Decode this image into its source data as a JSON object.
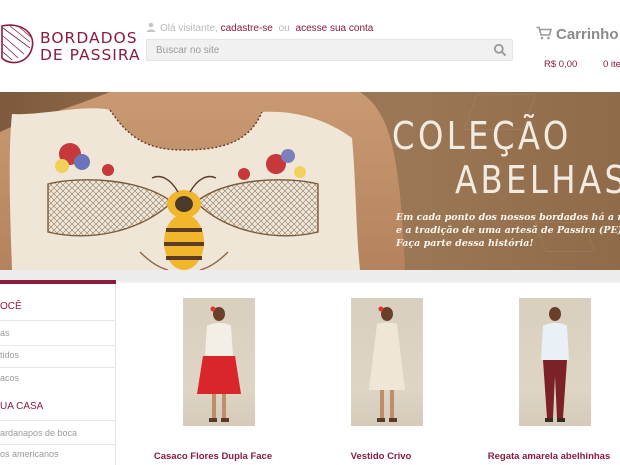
{
  "brand": {
    "line1": "BORDADOS",
    "line2": "DE PASSIRA",
    "color": "#8b1c3b"
  },
  "account": {
    "greeting": "Olá visitante,",
    "signup": "cadastre-se",
    "or": "ou",
    "login": "acesse sua conta",
    "icon": "user-icon"
  },
  "search": {
    "placeholder": "Buscar no site",
    "icon": "search-icon"
  },
  "cart": {
    "title": "Carrinho",
    "total": "R$ 0,00",
    "items": "0 ite",
    "icon": "cart-icon"
  },
  "banner": {
    "title_line1": "COLEÇÃO",
    "title_line2": "ABELHAS",
    "text_line1": "Em cada ponto dos nossos bordados há a memó",
    "text_line2": "e a tradição de uma artesã de Passira (PE).",
    "text_line3": "Faça parte dessa história!"
  },
  "sidebar": {
    "section1": {
      "heading": "OCÊ",
      "items": [
        "as",
        "tidos",
        "acos"
      ]
    },
    "section2": {
      "heading": "UA CASA",
      "items": [
        "ardanapos de boca",
        "os americanos"
      ]
    }
  },
  "products": [
    {
      "name": "Casaco Flores Dupla Face",
      "skirt_color": "#d8262a",
      "top_color": "#f4efe6"
    },
    {
      "name": "Vestido Crivo",
      "skirt_color": "#efe7d6",
      "top_color": "#efe7d6"
    },
    {
      "name": "Regata amarela abelhinhas",
      "skirt_color": "#7a2226",
      "top_color": "#eaf1f6"
    }
  ]
}
